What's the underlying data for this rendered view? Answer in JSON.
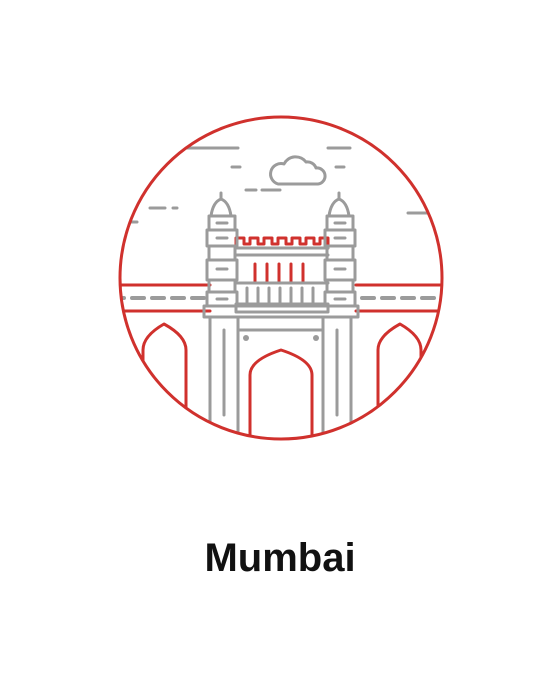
{
  "city": {
    "name": "Mumbai"
  },
  "illustration": {
    "subject": "gateway-of-india-icon",
    "colors": {
      "accent": "#d0312d",
      "line": "#9b9b9b",
      "text": "#111111"
    }
  }
}
